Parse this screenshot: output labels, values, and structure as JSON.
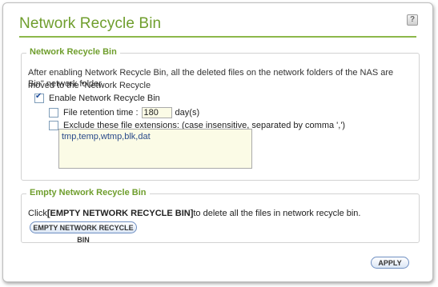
{
  "window": {
    "title": "Network Recycle Bin",
    "help_icon": "?"
  },
  "recycle_section": {
    "legend": "Network Recycle Bin",
    "description_line1": "After enabling Network Recycle Bin, all the deleted files on the network folders of the NAS are moved to the \"Network Recycle",
    "description_line2": "Bin\" network folder.",
    "enable_label": "Enable Network Recycle Bin",
    "enable_checked": true,
    "retention_label": "File retention time :",
    "retention_checked": false,
    "retention_value": "180",
    "retention_unit": "day(s)",
    "exclude_label": "Exclude these file extensions:  (case insensitive, separated by comma ',')",
    "exclude_checked": false,
    "extensions_value": "tmp,temp,wtmp,blk,dat"
  },
  "empty_section": {
    "legend": "Empty Network Recycle Bin",
    "instruction_prefix": "Click ",
    "instruction_bold": "[EMPTY NETWORK RECYCLE BIN]",
    "instruction_suffix": " to delete all the files in network recycle bin.",
    "empty_button_label": "EMPTY NETWORK RECYCLE BIN"
  },
  "footer": {
    "apply_label": "APPLY"
  }
}
